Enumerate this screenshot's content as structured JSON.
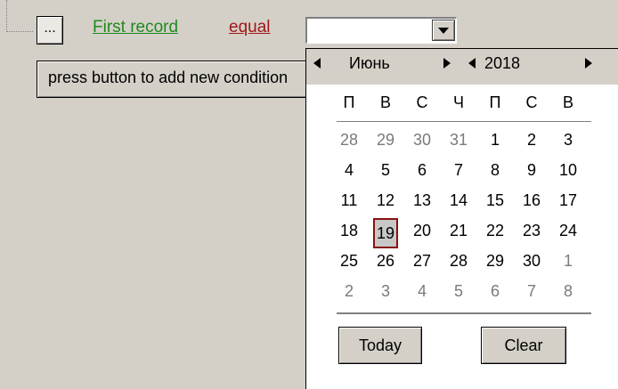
{
  "row": {
    "ellipsis_label": "...",
    "field_link": "First record",
    "operator_link": "equal",
    "value": ""
  },
  "hint": "press button to add new condition",
  "calendar": {
    "month": "Июнь",
    "year": "2018",
    "weekdays": [
      "П",
      "В",
      "С",
      "Ч",
      "П",
      "С",
      "В"
    ],
    "weeks": [
      [
        {
          "d": "28",
          "other": true
        },
        {
          "d": "29",
          "other": true
        },
        {
          "d": "30",
          "other": true
        },
        {
          "d": "31",
          "other": true
        },
        {
          "d": "1"
        },
        {
          "d": "2"
        },
        {
          "d": "3"
        }
      ],
      [
        {
          "d": "4"
        },
        {
          "d": "5"
        },
        {
          "d": "6"
        },
        {
          "d": "7"
        },
        {
          "d": "8"
        },
        {
          "d": "9"
        },
        {
          "d": "10"
        }
      ],
      [
        {
          "d": "11"
        },
        {
          "d": "12"
        },
        {
          "d": "13"
        },
        {
          "d": "14"
        },
        {
          "d": "15"
        },
        {
          "d": "16"
        },
        {
          "d": "17"
        }
      ],
      [
        {
          "d": "18"
        },
        {
          "d": "19",
          "selected": true
        },
        {
          "d": "20"
        },
        {
          "d": "21"
        },
        {
          "d": "22"
        },
        {
          "d": "23"
        },
        {
          "d": "24"
        }
      ],
      [
        {
          "d": "25"
        },
        {
          "d": "26"
        },
        {
          "d": "27"
        },
        {
          "d": "28"
        },
        {
          "d": "29"
        },
        {
          "d": "30"
        },
        {
          "d": "1",
          "other": true
        }
      ],
      [
        {
          "d": "2",
          "other": true
        },
        {
          "d": "3",
          "other": true
        },
        {
          "d": "4",
          "other": true
        },
        {
          "d": "5",
          "other": true
        },
        {
          "d": "6",
          "other": true
        },
        {
          "d": "7",
          "other": true
        },
        {
          "d": "8",
          "other": true
        }
      ]
    ],
    "today_label": "Today",
    "clear_label": "Clear",
    "colors": {
      "selected_border": "#8a1010",
      "other_month": "#7a7a7a"
    }
  }
}
